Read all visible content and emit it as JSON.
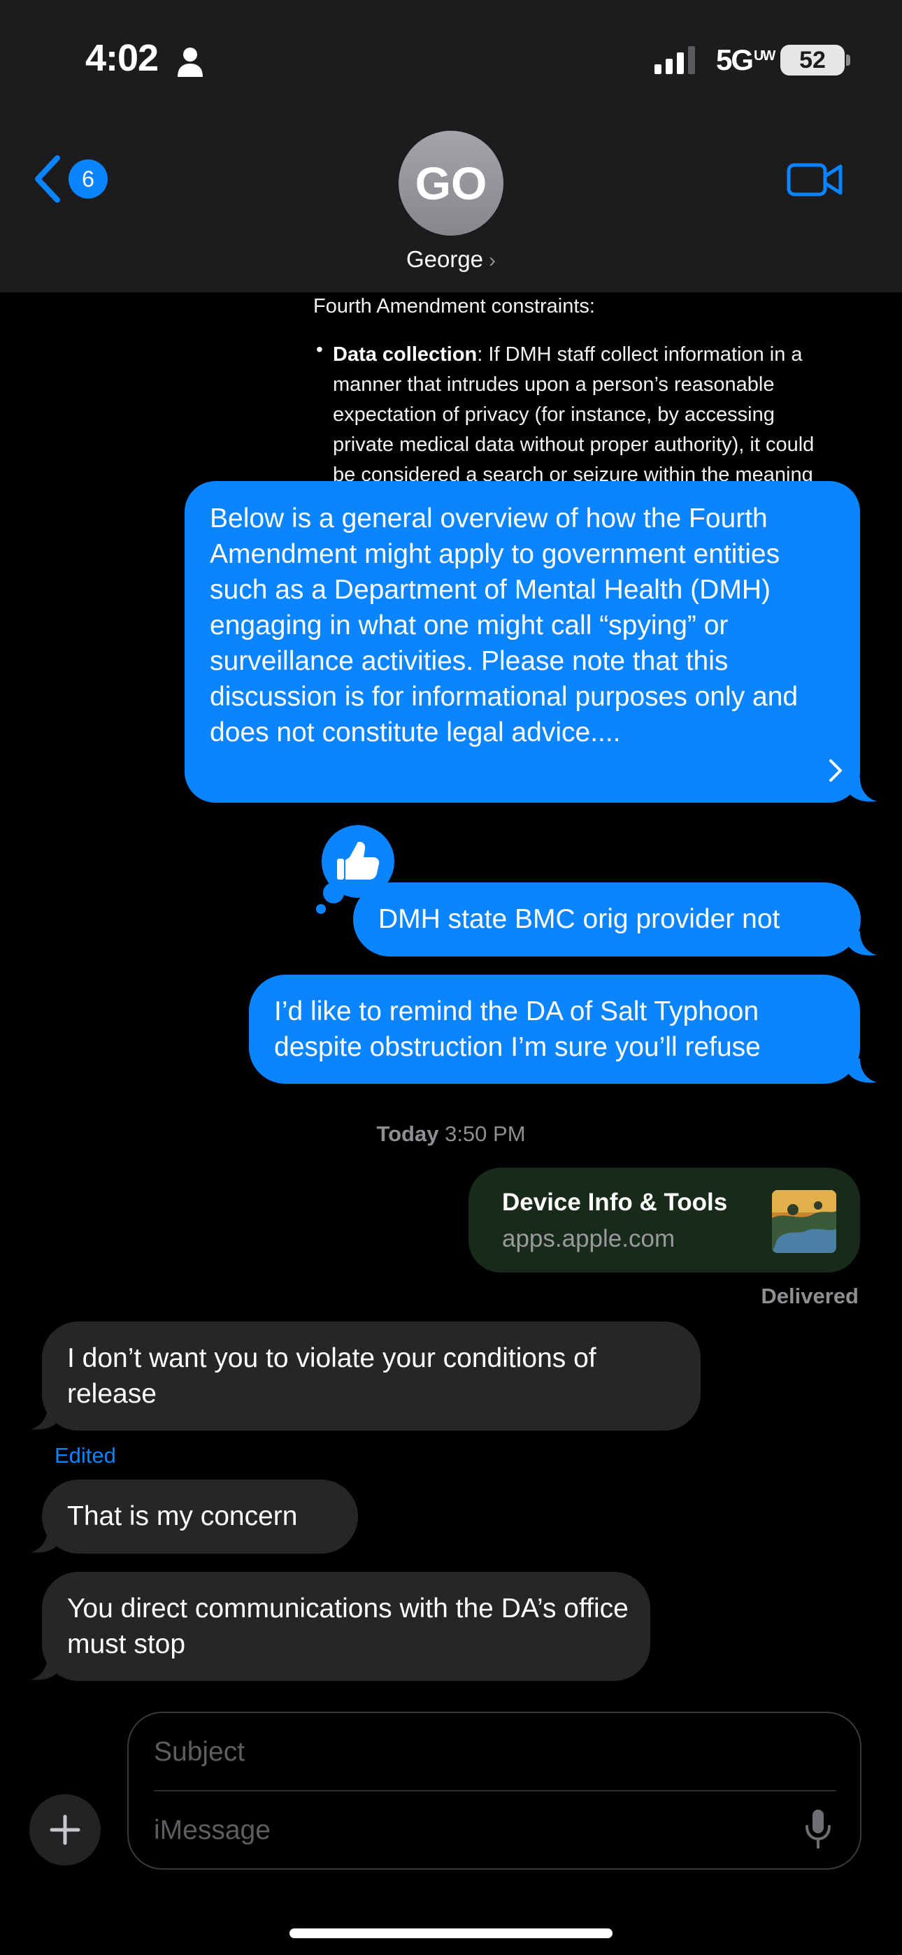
{
  "status_bar": {
    "time": "4:02",
    "network": "5G",
    "network_sup": "UW",
    "battery": "52"
  },
  "header": {
    "back_badge": "6",
    "avatar_initials": "GO",
    "contact_name": "George",
    "contact_chevron": "›",
    "accent_color": "#0a84ff"
  },
  "messages": {
    "snippet": {
      "heading": "Fourth Amendment constraints:",
      "bullet": "•",
      "bold_lead": "Data collection",
      "text": ": If DMH staff collect information in a manner that intrudes upon a person’s reasonable expectation of privacy (for instance, by accessing private medical data without proper authority), it could be considered a search or seizure within the meaning of the Fourth Amendment."
    },
    "overview": "Below is a general overview of how the Fourth Amendment might apply to government entities such as a Department of Mental Health (DMH) engaging in what one might call “spying” or surveillance activities. Please note that this discussion is for informational purposes only and does not constitute legal advice....",
    "dmh": "DMH state BMC orig provider not",
    "da": "I’d like to remind the DA of Salt Typhoon despite obstruction I’m sure you’ll refuse",
    "timestamp_day": "Today",
    "timestamp_time": "3:50 PM",
    "link_card": {
      "title": "Device Info & Tools",
      "url": "apps.apple.com"
    },
    "delivered": "Delivered",
    "release": "I don’t want you to violate your conditions of release",
    "edited": "Edited",
    "concern": "That is my concern",
    "direct": "You direct communications with the DA’s office must stop"
  },
  "composer": {
    "subject_placeholder": "Subject",
    "message_placeholder": "iMessage"
  },
  "icons": {
    "back": "chevron-left-icon",
    "person": "person-icon",
    "video": "video-camera-icon",
    "tapback": "thumbs-up-icon",
    "plus": "plus-icon",
    "mic": "microphone-icon"
  }
}
